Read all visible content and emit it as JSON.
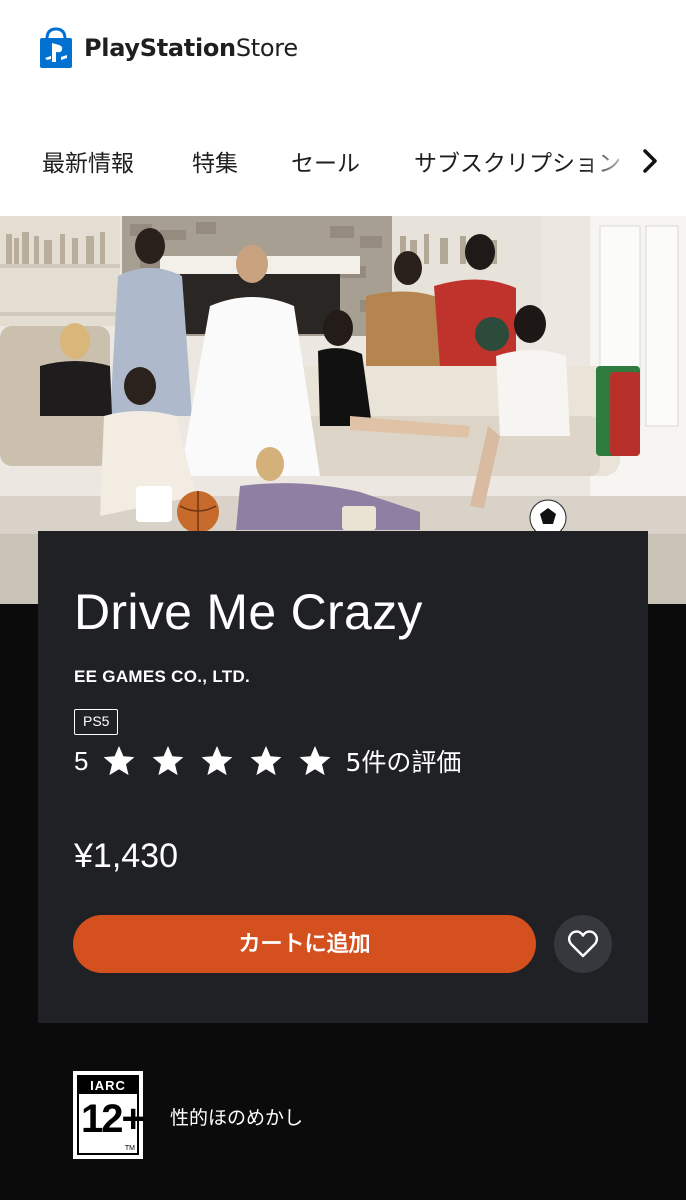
{
  "header": {
    "brand_name": "PlayStation",
    "brand_suffix": "Store",
    "nav": [
      {
        "label": "最新情報"
      },
      {
        "label": "特集"
      },
      {
        "label": "セール"
      },
      {
        "label": "サブスクリプション"
      }
    ]
  },
  "product": {
    "title": "Drive Me Crazy",
    "publisher": "EE GAMES CO., LTD.",
    "platform": "PS5",
    "rating_value": "5",
    "rating_stars": 5,
    "rating_count": "5件の評価",
    "price": "¥1,430",
    "add_to_cart_label": "カートに追加"
  },
  "age_rating": {
    "system": "IARC",
    "age": "12+",
    "tm": "TM",
    "descriptor": "性的ほのめかし"
  },
  "colors": {
    "accent": "#d5501f",
    "card_bg": "#202125",
    "page_bg": "#0b0b0b",
    "brand_blue": "#0070d1"
  }
}
